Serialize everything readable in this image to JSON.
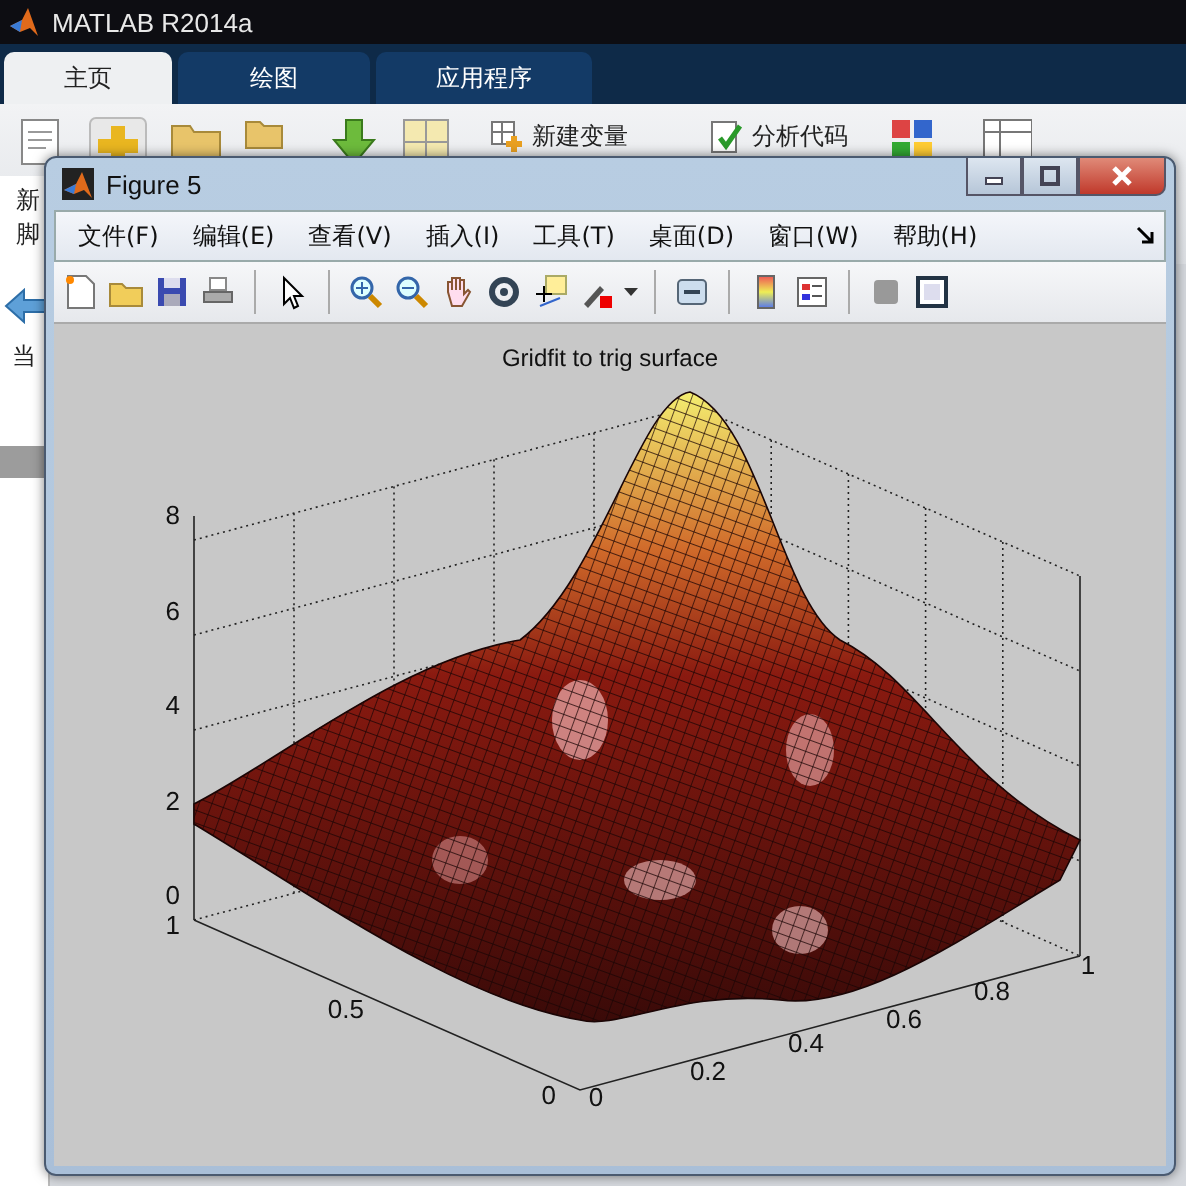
{
  "app_window": {
    "title": "MATLAB R2014a"
  },
  "tabs": [
    {
      "label": "主页",
      "selected": true
    },
    {
      "label": "绘图",
      "selected": false
    },
    {
      "label": "应用程序",
      "selected": false
    }
  ],
  "ribbon": {
    "buttons": [
      "新建变量",
      "分析代码"
    ],
    "side_texts": [
      "新",
      "脚",
      "当"
    ]
  },
  "figure_window": {
    "title": "Figure 5",
    "menu": [
      "文件(F)",
      "编辑(E)",
      "查看(V)",
      "插入(I)",
      "工具(T)",
      "桌面(D)",
      "窗口(W)",
      "帮助(H)"
    ],
    "plot": {
      "title": "Gridfit to trig surface",
      "z_ticks": [
        "8",
        "6",
        "4",
        "2",
        "0"
      ],
      "y_ticks": [
        "1",
        "0.5",
        "0"
      ],
      "x_ticks": [
        "0",
        "0.2",
        "0.4",
        "0.6",
        "0.8",
        "1"
      ]
    }
  }
}
